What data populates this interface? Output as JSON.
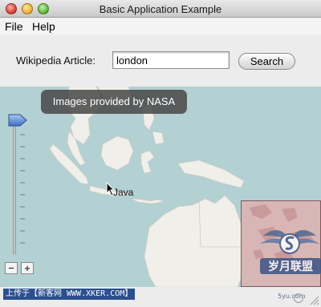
{
  "window": {
    "title": "Basic Application Example"
  },
  "menu": {
    "file": "File",
    "help": "Help"
  },
  "search": {
    "label": "Wikipedia Article:",
    "value": "london",
    "button": "Search"
  },
  "map": {
    "tooltip": "Images provided by NASA",
    "place_label": "Java",
    "zoom_out": "−",
    "zoom_in": "+",
    "zoom_level_fraction": 0.0
  },
  "footer": {
    "text": "上传于【新客网 WWW.XKER.COM】"
  },
  "watermark": {
    "brand": "岁月联盟",
    "url": "5yu.com"
  },
  "colors": {
    "ocean": "#b3d0d3",
    "land": "#f1efe9",
    "minimap": "#d8b6b6",
    "tooltip_bg": "#464646",
    "footer_bg": "#2b4f8f"
  }
}
